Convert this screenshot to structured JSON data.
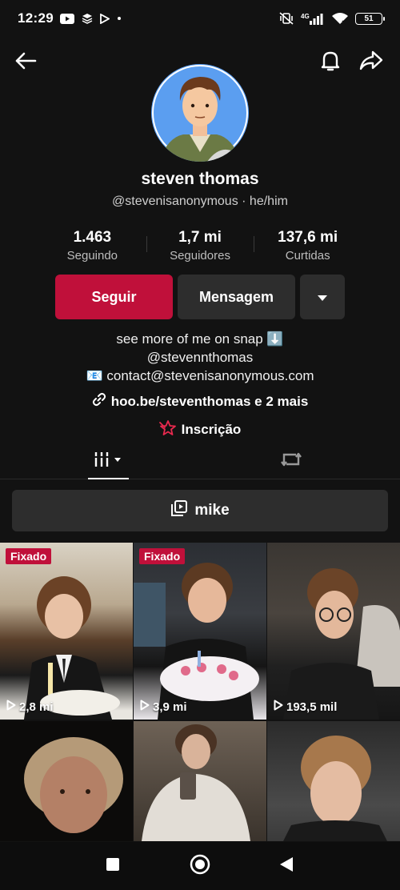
{
  "status_bar": {
    "time": "12:29",
    "network": "4G",
    "battery": "51"
  },
  "profile": {
    "display_name": "steven thomas",
    "handle_line": "@stevenisanonymous · he/him",
    "stats": [
      {
        "value": "1.463",
        "label": "Seguindo"
      },
      {
        "value": "1,7 mi",
        "label": "Seguidores"
      },
      {
        "value": "137,6 mi",
        "label": "Curtidas"
      }
    ],
    "buttons": {
      "follow": "Seguir",
      "message": "Mensagem"
    },
    "bio": [
      "see more of me on snap ⬇️",
      "@stevennthomas",
      "📧 contact@stevenisanonymous.com"
    ],
    "link_text": "hoo.be/steventhomas e 2 mais",
    "subscribe_text": "Inscrição"
  },
  "playlist": {
    "label": "mike"
  },
  "videos": [
    {
      "pinned": "Fixado",
      "views": "2,8 mi"
    },
    {
      "pinned": "Fixado",
      "views": "3,9 mi"
    },
    {
      "pinned": "",
      "views": "193,5 mil"
    },
    {
      "pinned": "",
      "views": ""
    },
    {
      "pinned": "",
      "views": ""
    },
    {
      "pinned": "",
      "views": ""
    }
  ],
  "colors": {
    "accent": "#c0103a",
    "background": "#121212",
    "button_secondary": "#2d2d2d"
  },
  "icons": [
    "back-arrow-icon",
    "bell-icon",
    "share-icon",
    "dropdown-caret-icon",
    "link-icon",
    "subscribe-star-icon",
    "grid-videos-icon",
    "repost-icon",
    "playlist-icon",
    "play-icon"
  ]
}
